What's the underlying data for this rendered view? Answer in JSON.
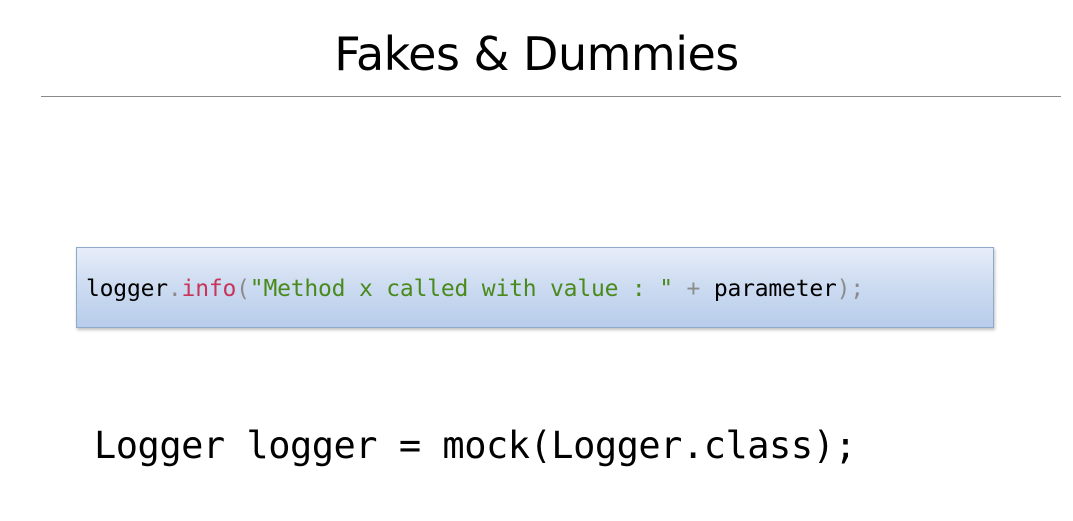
{
  "slide": {
    "title": "Fakes & Dummies",
    "code_snippet": {
      "object": "logger",
      "dot": ".",
      "method": "info",
      "open_paren": "(",
      "string_literal": "\"Method x called with value : \"",
      "plus": " + ",
      "argument": "parameter",
      "close_paren": ")",
      "semicolon": ";"
    },
    "statement": "Logger logger = mock(Logger.class);"
  },
  "colors": {
    "method": "#c8345a",
    "string": "#4a8a1c",
    "punctuation": "#8c8c8c",
    "code_box_top": "#e6edf8",
    "code_box_bottom": "#b8cdeb"
  }
}
